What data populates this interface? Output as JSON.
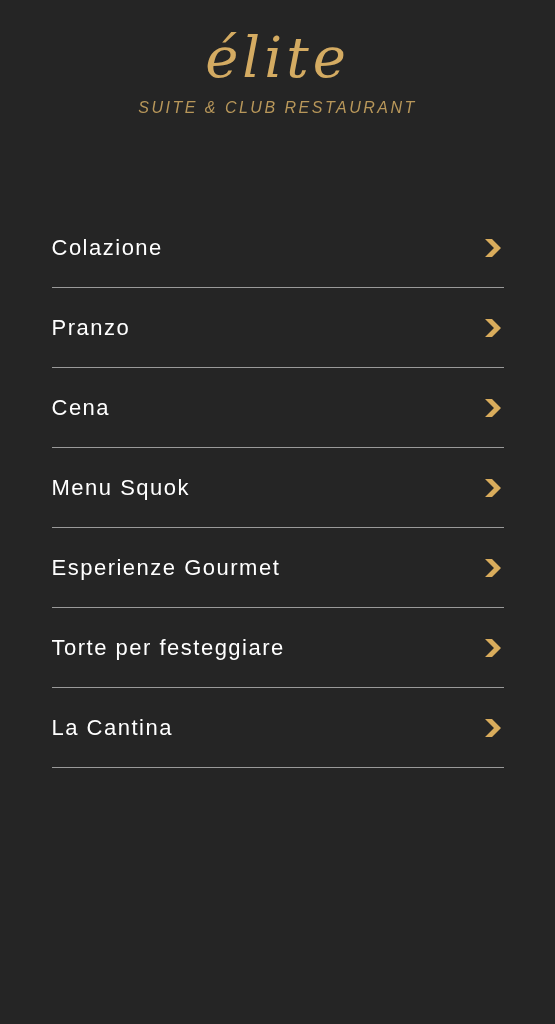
{
  "logo": {
    "wordmark": "élite",
    "tagline": "SUITE & CLUB RESTAURANT"
  },
  "menu": [
    {
      "label": "Colazione"
    },
    {
      "label": "Pranzo"
    },
    {
      "label": "Cena"
    },
    {
      "label": "Menu Squok"
    },
    {
      "label": "Esperienze Gourmet"
    },
    {
      "label": "Torte per festeggiare"
    },
    {
      "label": "La Cantina"
    }
  ]
}
